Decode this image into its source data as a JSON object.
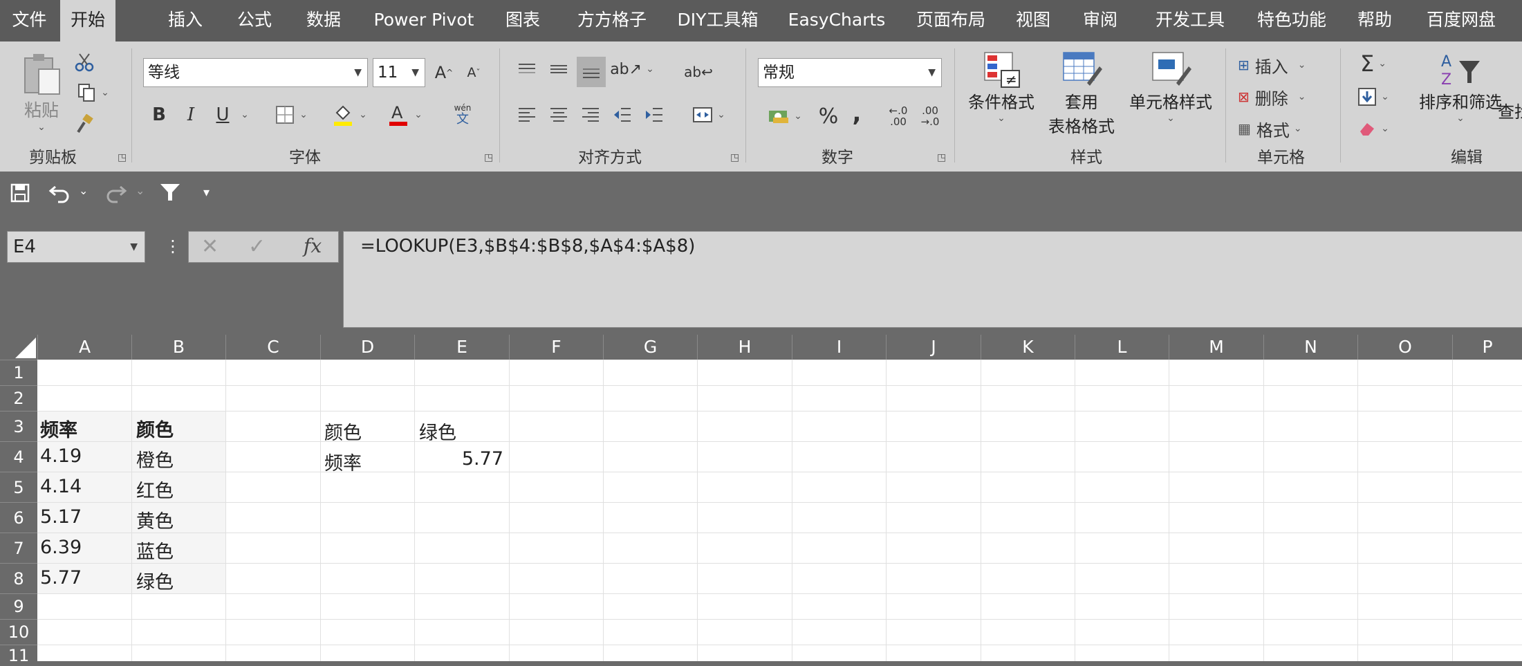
{
  "tabs": [
    "文件",
    "开始",
    "插入",
    "公式",
    "数据",
    "Power Pivot",
    "图表",
    "方方格子",
    "DIY工具箱",
    "EasyCharts",
    "页面布局",
    "视图",
    "审阅",
    "开发工具",
    "特色功能",
    "帮助",
    "百度网盘"
  ],
  "active_tab": "开始",
  "ribbon": {
    "clipboard": {
      "label": "剪贴板",
      "paste": "粘贴"
    },
    "font": {
      "label": "字体",
      "name": "等线",
      "size": "11",
      "bold": "B",
      "italic": "I",
      "underline": "U",
      "grow": "A",
      "shrink": "A",
      "phonetic_top": "wén",
      "phonetic_bottom": "文"
    },
    "alignment": {
      "label": "对齐方式"
    },
    "number": {
      "label": "数字",
      "format": "常规",
      "percent": "%",
      "comma": ",",
      "inc_decimal_top": "←.0",
      "inc_decimal_bottom": ".00",
      "dec_decimal_top": ".00",
      "dec_decimal_bottom": "→.0"
    },
    "styles": {
      "label": "样式",
      "conditional": "条件格式",
      "table_line1": "套用",
      "table_line2": "表格格式",
      "cell_styles": "单元格样式"
    },
    "cells": {
      "label": "单元格",
      "insert": "插入",
      "delete": "删除",
      "format": "格式"
    },
    "editing": {
      "label": "编辑",
      "sort_filter": "排序和筛选",
      "find": "查找"
    }
  },
  "formula_bar": {
    "name_box": "E4",
    "fx": "fx",
    "formula": "=LOOKUP(E3,$B$4:$B$8,$A$4:$A$8)"
  },
  "columns": [
    "A",
    "B",
    "C",
    "D",
    "E",
    "F",
    "G",
    "H",
    "I",
    "J",
    "K",
    "L",
    "M",
    "N",
    "O",
    "P"
  ],
  "rows": [
    "1",
    "2",
    "3",
    "4",
    "5",
    "6",
    "7",
    "8",
    "9",
    "10",
    "11"
  ],
  "table": {
    "header": {
      "a": "频率",
      "b": "颜色"
    },
    "rows": [
      {
        "a": "4.19",
        "b": "橙色"
      },
      {
        "a": "4.14",
        "b": "红色"
      },
      {
        "a": "5.17",
        "b": "黄色"
      },
      {
        "a": "6.39",
        "b": "蓝色"
      },
      {
        "a": "5.77",
        "b": "绿色"
      }
    ]
  },
  "lookup": {
    "d3": "颜色",
    "e3": "绿色",
    "d4": "频率",
    "e4": "5.77"
  },
  "colors": {
    "accent_red": "#e00000",
    "highlight_yellow": "#ffeb00",
    "cell_styles_blue": "#2f6db5"
  }
}
